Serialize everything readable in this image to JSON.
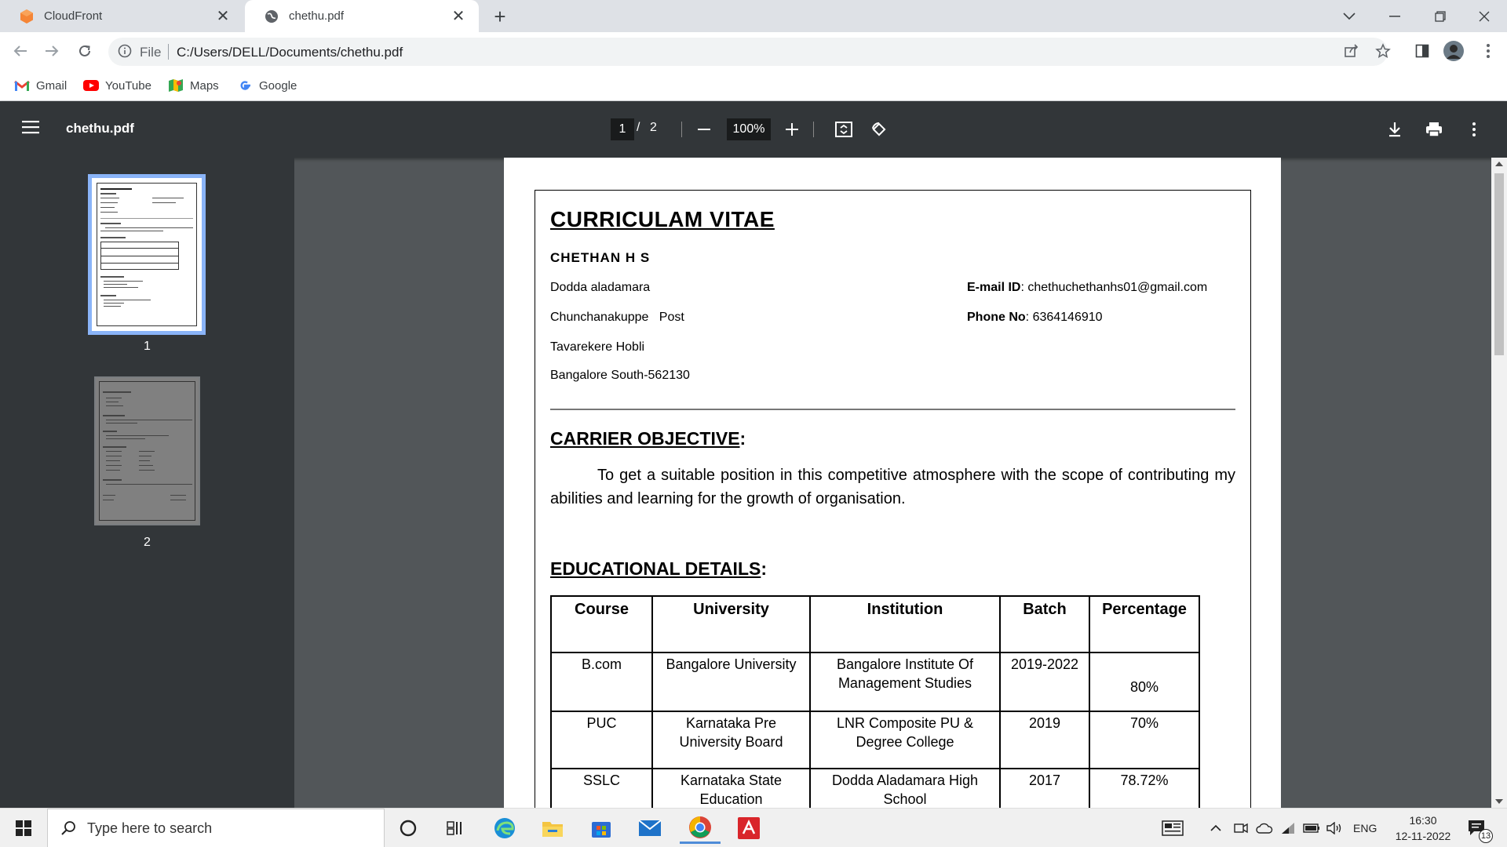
{
  "browser": {
    "tabs": [
      {
        "title": "CloudFront",
        "active": false
      },
      {
        "title": "chethu.pdf",
        "active": true
      }
    ],
    "address": {
      "scheme_label": "File",
      "url": "C:/Users/DELL/Documents/chethu.pdf"
    },
    "bookmarks": [
      "Gmail",
      "YouTube",
      "Maps",
      "Google"
    ]
  },
  "pdf_viewer": {
    "file_name": "chethu.pdf",
    "current_page": "1",
    "page_separator": "/",
    "total_pages": "2",
    "zoom": "100%",
    "thumbnails": [
      "1",
      "2"
    ]
  },
  "document": {
    "title": "CURRICULAM VITAE",
    "name": "CHETHAN  H S",
    "address": [
      "Dodda aladamara",
      "Chunchanakuppe   Post",
      "Tavarekere Hobli",
      "Bangalore South-562130"
    ],
    "email_label": "E-mail ID",
    "email": ": chethuchethanhs01@gmail.com",
    "phone_label": "Phone No",
    "phone": ": 6364146910",
    "objective_heading": "CARRIER OBJECTIVE",
    "objective_colon": ":",
    "objective_text": "To get a suitable position in this competitive atmosphere with the scope of contributing my abilities and learning for the growth of organisation.",
    "education_heading": "EDUCATIONAL DETAILS",
    "education_colon": ":",
    "education_columns": [
      "Course",
      "University",
      "Institution",
      "Batch",
      "Percentage"
    ],
    "education_rows": [
      [
        "B.com",
        "Bangalore University",
        "Bangalore Institute Of Management Studies",
        "2019-2022",
        "80%"
      ],
      [
        "PUC",
        "Karnataka Pre University Board",
        "LNR Composite PU & Degree College",
        "2019",
        "70%"
      ],
      [
        "SSLC",
        "Karnataka State Education",
        "Dodda Aladamara High School",
        "2017",
        "78.72%"
      ]
    ]
  },
  "taskbar": {
    "search_placeholder": "Type here to search",
    "language": "ENG",
    "time": "16:30",
    "date": "12-11-2022",
    "notification_count": "13"
  },
  "colors": {
    "pdf_toolbar": "#323639",
    "viewer_background": "#525659",
    "thumbnail_selection": "#8ab4f8"
  }
}
